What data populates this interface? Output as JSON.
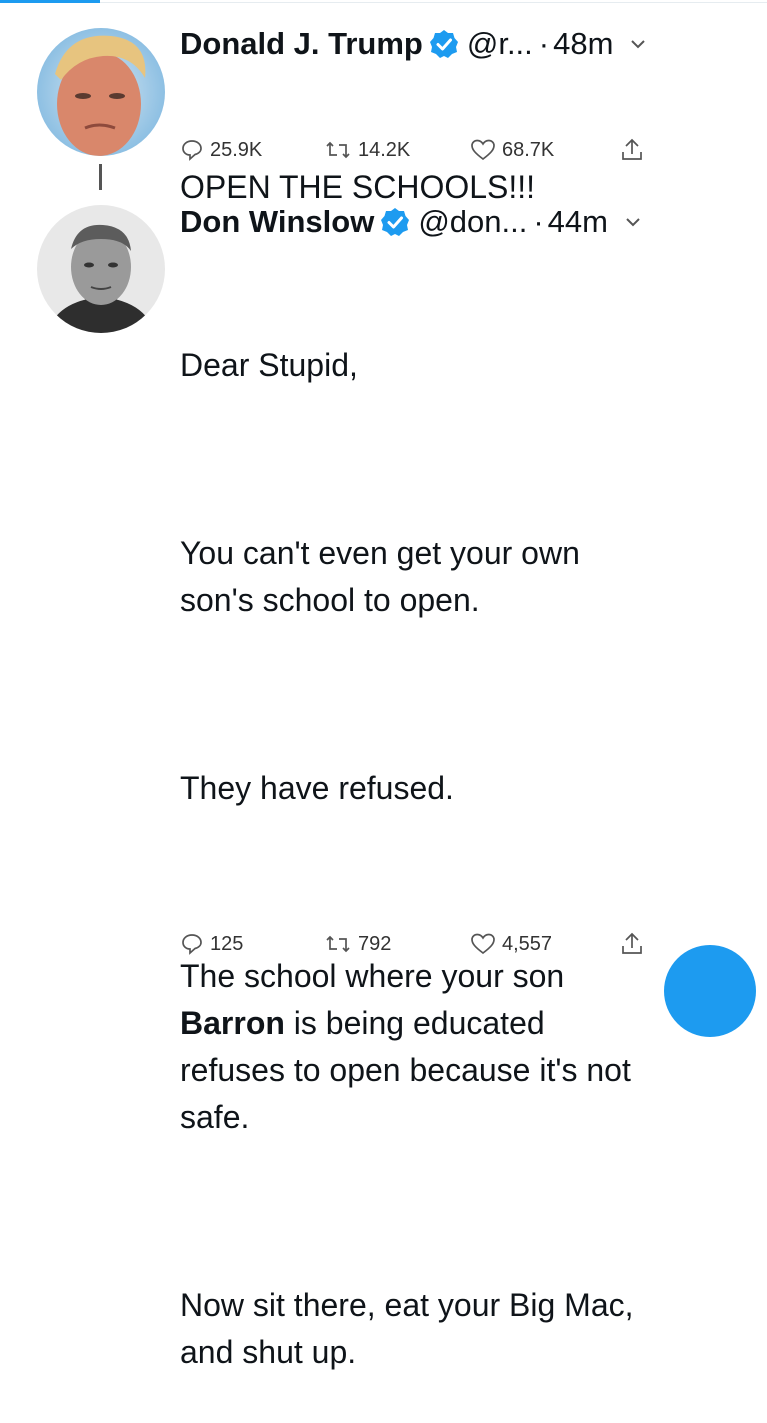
{
  "tweets": [
    {
      "author": "Donald J. Trump",
      "handle": "@r...",
      "time": "48m",
      "text_lines": [
        "OPEN THE SCHOOLS!!!"
      ],
      "stats": {
        "replies": "25.9K",
        "retweets": "14.2K",
        "likes": "68.7K"
      }
    },
    {
      "author": "Don Winslow",
      "handle": "@don...",
      "time": "44m",
      "greeting": "Dear Stupid,",
      "p1": "You can't even get your own\nson's school to open.",
      "p2": "They have refused.",
      "p3_bold": "Barron",
      "p3_lead": "The school where your son\n",
      "p3_rest": " is being educated\nrefuses to open because it's not\nsafe.",
      "p4": "Now sit there, eat your Big Mac,\nand shut up.",
      "stats": {
        "replies": "125",
        "retweets": "792",
        "likes": "4,557"
      }
    }
  ],
  "separator": "·",
  "colors": {
    "accent": "#1d9bf0",
    "text": "#0f1419",
    "muted": "#333333"
  },
  "icons": [
    "verified-badge-icon",
    "chevron-down-icon",
    "reply-icon",
    "retweet-icon",
    "like-icon",
    "share-icon"
  ]
}
